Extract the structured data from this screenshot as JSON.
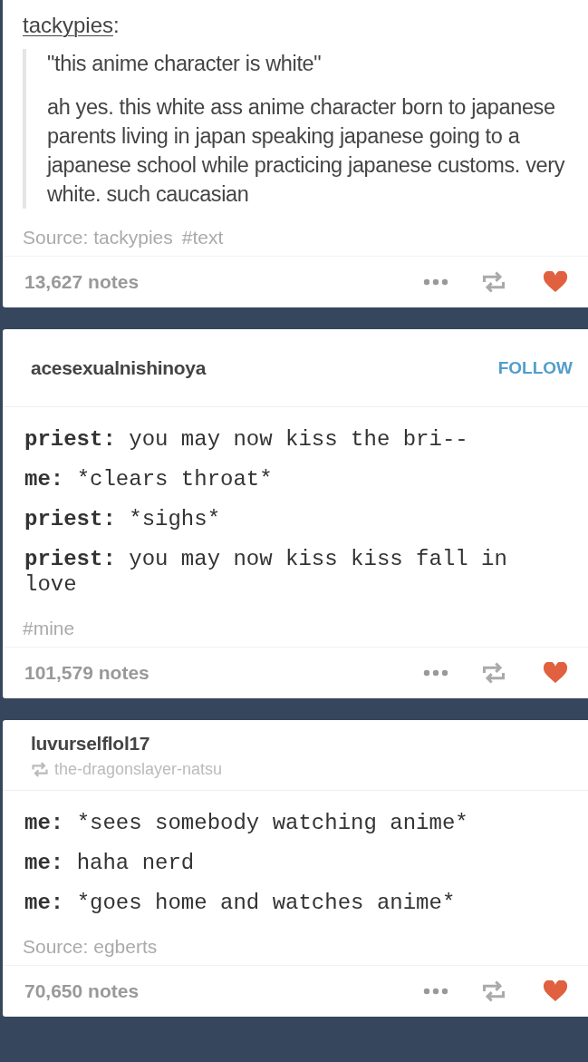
{
  "posts": [
    {
      "header": {
        "kind": "attribution",
        "username": "tackypies",
        "colon": ":"
      },
      "body": {
        "kind": "quote",
        "paragraphs": [
          "\"this anime character is white\"",
          "ah yes. this white ass anime character born to japanese parents living in japan speaking japanese going to a japanese school while practicing japanese customs. very white. such caucasian"
        ]
      },
      "meta": {
        "source": "Source: tackypies",
        "tags": [
          "#text"
        ]
      },
      "footer": {
        "notes": "13,627 notes",
        "liked": true
      }
    },
    {
      "header": {
        "kind": "blog",
        "username": "acesexualnishinoya",
        "follow": "FOLLOW"
      },
      "body": {
        "kind": "chat",
        "lines": [
          {
            "speaker": "priest:",
            "text": "you may now kiss the bri--"
          },
          {
            "speaker": "me:",
            "text": "*clears throat*"
          },
          {
            "speaker": "priest:",
            "text": "*sighs*"
          },
          {
            "speaker": "priest:",
            "text": "you may now kiss kiss fall in love"
          }
        ]
      },
      "meta": {
        "tags": [
          "#mine"
        ]
      },
      "footer": {
        "notes": "101,579 notes",
        "liked": true
      }
    },
    {
      "header": {
        "kind": "blog",
        "username": "luvurselflol17",
        "reblogged_from": "the-dragonslayer-natsu"
      },
      "body": {
        "kind": "chat",
        "lines": [
          {
            "speaker": "me:",
            "text": "*sees somebody watching anime*"
          },
          {
            "speaker": "me:",
            "text": "haha nerd"
          },
          {
            "speaker": "me:",
            "text": "*goes home and watches anime*"
          }
        ]
      },
      "meta": {
        "source": "Source: egberts"
      },
      "footer": {
        "notes": "70,650 notes",
        "liked": true
      }
    }
  ]
}
